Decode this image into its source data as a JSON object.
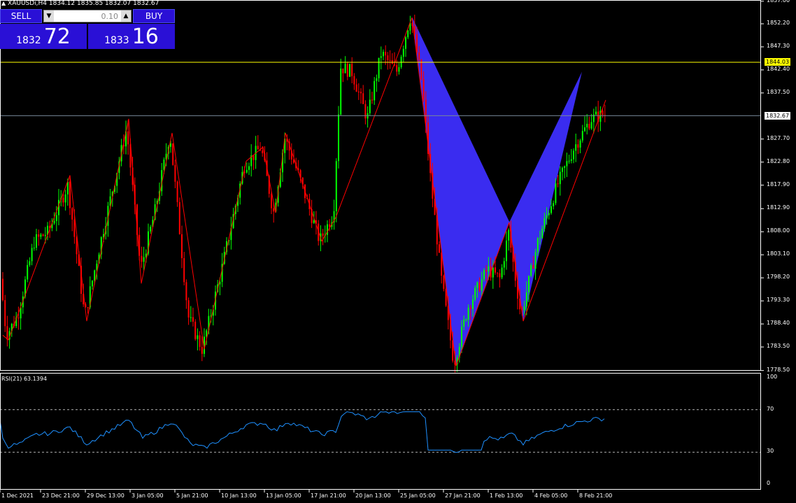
{
  "header": {
    "symbol_line": "XAUUSDi,H4  1834.12 1835.85 1832.07 1832.67"
  },
  "trade_panel": {
    "sell_label": "SELL",
    "buy_label": "BUY",
    "lot_value": "0.10",
    "sell_price_prefix": "1832",
    "sell_price_big": "72",
    "buy_price_prefix": "1833",
    "buy_price_big": "16"
  },
  "price_axis": {
    "labels": [
      "1857.00",
      "1852.20",
      "1847.30",
      "1842.40",
      "1837.50",
      "1832.67",
      "1827.70",
      "1822.80",
      "1817.90",
      "1812.90",
      "1808.00",
      "1803.10",
      "1798.20",
      "1793.30",
      "1788.40",
      "1783.50",
      "1778.50"
    ],
    "values": [
      1857.0,
      1852.2,
      1847.3,
      1842.4,
      1837.5,
      1832.67,
      1827.7,
      1822.8,
      1817.9,
      1812.9,
      1808.0,
      1803.1,
      1798.2,
      1793.3,
      1788.4,
      1783.5,
      1778.5
    ],
    "yellow_line_label": "1844.03",
    "yellow_line_value": 1844.03,
    "bid_line_label": "1832.67",
    "bid_line_value": 1832.67
  },
  "time_axis": {
    "labels": [
      "1 Dec 2021",
      "23 Dec 21:00",
      "29 Dec 13:00",
      "3 Jan 05:00",
      "5 Jan 21:00",
      "10 Jan 13:00",
      "13 Jan 05:00",
      "17 Jan 21:00",
      "20 Jan 13:00",
      "25 Jan 05:00",
      "27 Jan 21:00",
      "1 Feb 13:00",
      "4 Feb 05:00",
      "8 Feb 21:00"
    ]
  },
  "rsi": {
    "title": "RSI(21) 63.1394",
    "axis_labels": [
      "100",
      "70",
      "30",
      "0"
    ],
    "levels": [
      70,
      30
    ]
  },
  "colors": {
    "bull": "#00ff00",
    "bear": "#ff0000",
    "zigzag": "#ff0000",
    "pattern_fill": "#3a2cf0",
    "rsi_line": "#1e90ff",
    "yellow_line": "#ffff00",
    "bid_line": "#778899",
    "panel": "#2a10d6"
  }
}
